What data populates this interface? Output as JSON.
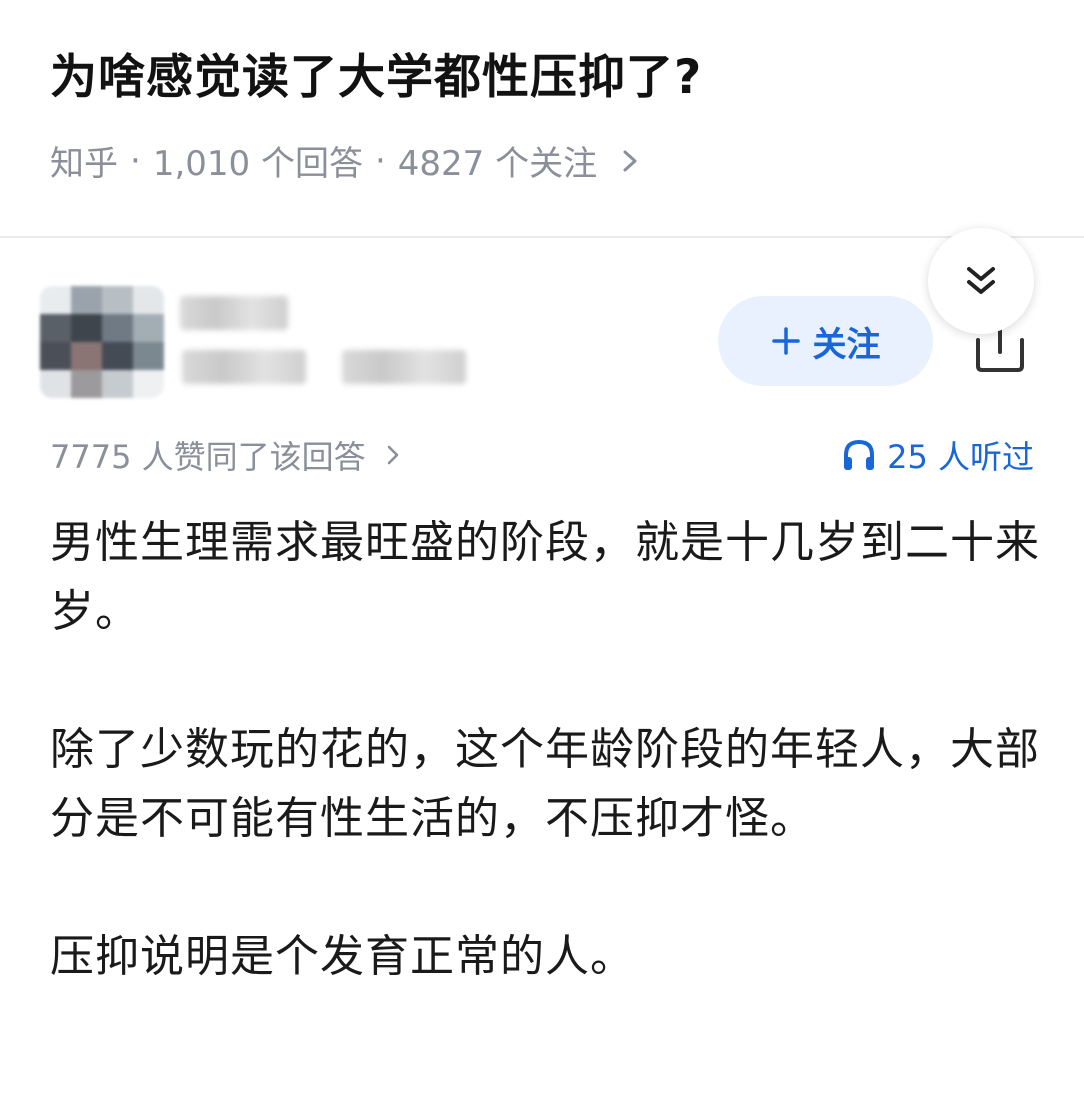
{
  "question": {
    "title": "为啥感觉读了大学都性压抑了?",
    "source": "知乎",
    "answers_count": "1,010 个回答",
    "followers_count": "4827 个关注",
    "separator": "·"
  },
  "author": {
    "follow_label": "关注",
    "follow_icon": "plus-icon",
    "share_icon": "share-icon"
  },
  "collapse_icon": "double-chevron-down-icon",
  "stats": {
    "upvotes": "7775 人赞同了该回答",
    "listens": "25 人听过",
    "listen_icon": "headphones-icon"
  },
  "answer": {
    "paragraphs": [
      "男性生理需求最旺盛的阶段，就是十几岁到二十来岁。",
      "除了少数玩的花的，这个年龄阶段的年轻人，大部分是不可能有性生活的，不压抑才怪。",
      "压抑说明是个发育正常的人。"
    ]
  },
  "colors": {
    "accent": "#1966d9",
    "follow_bg": "#e8f1fd",
    "meta_gray": "#8a8f99",
    "title": "#121212"
  }
}
